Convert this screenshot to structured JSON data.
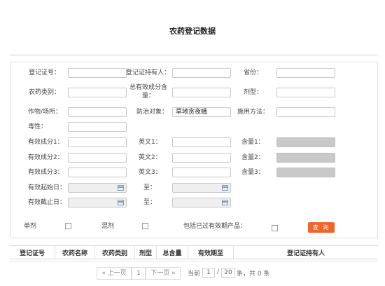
{
  "page": {
    "title": "农药登记数据"
  },
  "form": {
    "reg_no": {
      "label": "登记证号：",
      "value": ""
    },
    "holder": {
      "label": "登记证持有人：",
      "value": ""
    },
    "province": {
      "label": "省份：",
      "value": ""
    },
    "category": {
      "label": "农药类别：",
      "value": ""
    },
    "total_content": {
      "label": "总有效成分含量：",
      "value": ""
    },
    "dosage_form": {
      "label": "剂型：",
      "value": ""
    },
    "crop": {
      "label": "作物/场所：",
      "value": ""
    },
    "target": {
      "label": "防治对象：",
      "value": "草地贪夜蛾"
    },
    "method": {
      "label": "施用方法：",
      "value": ""
    },
    "toxicity": {
      "label": "毒性：",
      "value": ""
    },
    "ingredient1": {
      "label": "有效成分1：",
      "value": ""
    },
    "english1": {
      "label": "英文1：",
      "value": ""
    },
    "content1": {
      "label": "含量1：",
      "value": ""
    },
    "ingredient2": {
      "label": "有效成分2：",
      "value": ""
    },
    "english2": {
      "label": "英文2：",
      "value": ""
    },
    "content2": {
      "label": "含量2：",
      "value": ""
    },
    "ingredient3": {
      "label": "有效成分3：",
      "value": ""
    },
    "english3": {
      "label": "英文3：",
      "value": ""
    },
    "content3": {
      "label": "含量3：",
      "value": ""
    },
    "start_date": {
      "label": "有效起始日：",
      "value": "",
      "to_label": "至："
    },
    "end_date": {
      "label": "有效截止日：",
      "value": "",
      "to_label": "至："
    },
    "single": {
      "label": "单剂",
      "checked": false
    },
    "mixed": {
      "label": "混剂",
      "checked": false
    },
    "include_expired": {
      "label": "包括已过有效期产品：",
      "checked": false
    },
    "query_button": "查 询"
  },
  "results": {
    "columns": [
      "登记证号",
      "农药名称",
      "农药类别",
      "剂型",
      "总含量",
      "有效期至",
      "登记证持有人"
    ],
    "rows": []
  },
  "pagination": {
    "prev": "« 上一页",
    "current": "1",
    "next": "下一页 »",
    "current_label": "当前",
    "page_input": "1",
    "separator": "/",
    "total_pages": "20",
    "summary": "条，共 0 条"
  },
  "icons": {
    "calendar": "calendar-icon"
  },
  "colors": {
    "accent": "#f0642d"
  }
}
